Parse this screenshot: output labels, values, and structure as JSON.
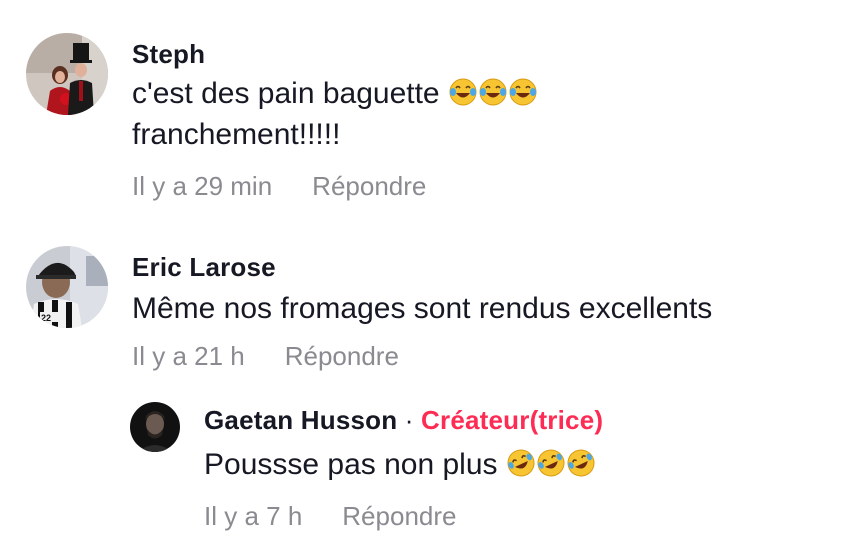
{
  "comments": [
    {
      "author": "Steph",
      "text_line1": "c'est des pain baguette",
      "text_line1_emojis": [
        "face-with-tears-of-joy",
        "face-with-tears-of-joy",
        "face-with-tears-of-joy"
      ],
      "text_line2": "franchement!!!!!",
      "time": "Il y a 29 min",
      "reply_label": "Répondre"
    },
    {
      "author": "Eric Larose",
      "text_line1": "Même nos fromages sont rendus excellents",
      "time": "Il y a 21 h",
      "reply_label": "Répondre"
    }
  ],
  "reply": {
    "author": "Gaetan Husson",
    "separator": "·",
    "creator_badge": "Créateur(trice)",
    "text_line1": "Poussse pas non plus",
    "text_line1_emojis": [
      "rolling-on-the-floor-laughing",
      "rolling-on-the-floor-laughing",
      "rolling-on-the-floor-laughing"
    ],
    "time": "Il y a 7 h",
    "reply_label": "Répondre"
  },
  "colors": {
    "text": "#161823",
    "meta": "#8a8b91",
    "creator": "#fe2c55"
  }
}
